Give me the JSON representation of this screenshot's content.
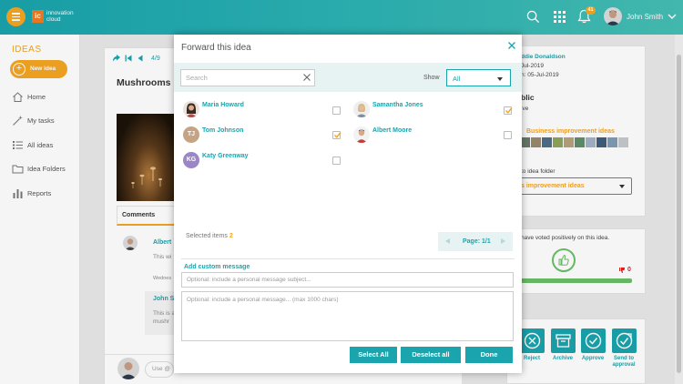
{
  "topbar": {
    "logo_mark": "ic",
    "logo_line1": "innovation",
    "logo_line2": "cloud",
    "notification_count": "41",
    "user_name": "John Smith"
  },
  "sidebar": {
    "title": "IDEAS",
    "new_idea_label": "New idea",
    "items": [
      {
        "label": "Home",
        "icon": "home-icon"
      },
      {
        "label": "My tasks",
        "icon": "wand-icon"
      },
      {
        "label": "All ideas",
        "icon": "list-icon"
      },
      {
        "label": "Idea Folders",
        "icon": "folder-icon"
      },
      {
        "label": "Reports",
        "icon": "bar-chart-icon"
      }
    ]
  },
  "idea": {
    "counter": "4/9",
    "title": "Mushrooms",
    "comments_tab": "Comments",
    "comment1_author": "Albert",
    "comment1_text": "This wi",
    "comment1_date": "Wednes",
    "comment2_author": "John S",
    "comment2_text_1": "This is a",
    "comment2_text_2": "mushr",
    "input_placeholder": "Use @"
  },
  "details": {
    "author": "ddie Donaldson",
    "date1": "Jul-2019",
    "date2": "n: 05-Jul-2019",
    "visibility": "blic",
    "status": "ive",
    "category": "Business improvement ideas",
    "move_label": "to idea folder",
    "folder_value": "s improvement ideas",
    "vote_text": "have voted positively on this idea.",
    "down_votes": "0",
    "actions": [
      {
        "label": "Reject",
        "icon": "reject-icon"
      },
      {
        "label": "Archive",
        "icon": "archive-icon"
      },
      {
        "label": "Approve",
        "icon": "approve-icon"
      },
      {
        "label": "Send to approval",
        "icon": "send-approval-icon"
      }
    ]
  },
  "modal": {
    "title": "Forward this idea",
    "search_placeholder": "Search",
    "show_label": "Show",
    "show_value": "All",
    "users": [
      {
        "name": "Maria Howard",
        "initials": "",
        "checked": false
      },
      {
        "name": "Samantha Jones",
        "initials": "",
        "checked": true
      },
      {
        "name": "Tom Johnson",
        "initials": "TJ",
        "checked": true
      },
      {
        "name": "Albert Moore",
        "initials": "",
        "checked": false
      },
      {
        "name": "Katy Greenway",
        "initials": "KG",
        "checked": false
      }
    ],
    "selected_label": "Selected items",
    "selected_count": "2",
    "page_label": "Page: 1/1",
    "custom_message_label": "Add custom message",
    "subject_placeholder": "Optional: include a personal message subject...",
    "message_placeholder": "Optional: include a personal message... (max 1000 chars)",
    "select_all": "Select All",
    "deselect_all": "Deselect all",
    "done": "Done"
  },
  "colors": {
    "teal": "#1aa4ad",
    "orange": "#f5a623",
    "green": "#6abf69",
    "red": "#e02020"
  }
}
